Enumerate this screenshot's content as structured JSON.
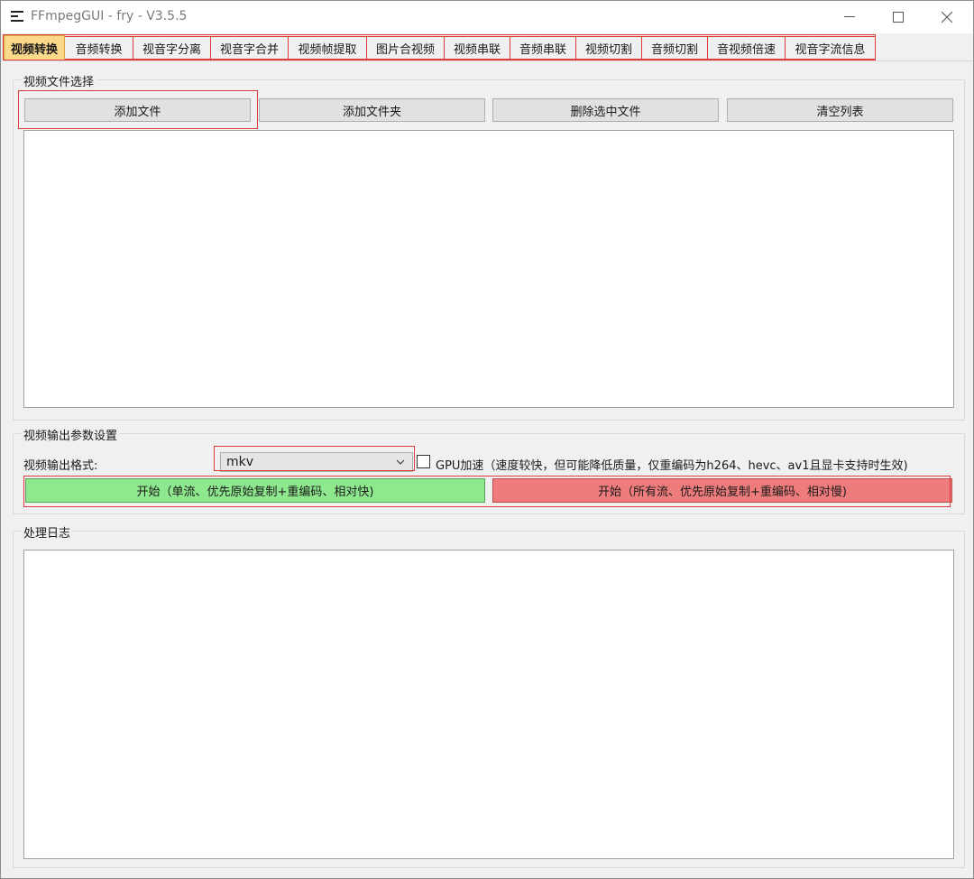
{
  "window": {
    "title": "FFmpegGUI - fry - V3.5.5"
  },
  "tabs": [
    {
      "label": "视频转换",
      "active": true
    },
    {
      "label": "音频转换",
      "active": false
    },
    {
      "label": "视音字分离",
      "active": false
    },
    {
      "label": "视音字合并",
      "active": false
    },
    {
      "label": "视频帧提取",
      "active": false
    },
    {
      "label": "图片合视频",
      "active": false
    },
    {
      "label": "视频串联",
      "active": false
    },
    {
      "label": "音频串联",
      "active": false
    },
    {
      "label": "视频切割",
      "active": false
    },
    {
      "label": "音频切割",
      "active": false
    },
    {
      "label": "音视频倍速",
      "active": false
    },
    {
      "label": "视音字流信息",
      "active": false
    }
  ],
  "file_select": {
    "title": "视频文件选择",
    "add_file": "添加文件",
    "add_folder": "添加文件夹",
    "delete_selected": "删除选中文件",
    "clear_list": "清空列表"
  },
  "output": {
    "title": "视频输出参数设置",
    "format_label": "视频输出格式:",
    "format_value": "mkv",
    "gpu_label": "GPU加速（速度较快，但可能降低质量，仅重编码为h264、hevc、av1且显卡支持时生效)",
    "gpu_checked": false,
    "start_fast": "开始（单流、优先原始复制+重编码、相对快)",
    "start_all": "开始（所有流、优先原始复制+重编码、相对慢)"
  },
  "log": {
    "title": "处理日志"
  },
  "colors": {
    "active_tab": "#fbd88a",
    "start_fast_bg": "#8ee88e",
    "start_all_bg": "#ef7c7c",
    "highlight_outline": "#e03b3b"
  }
}
